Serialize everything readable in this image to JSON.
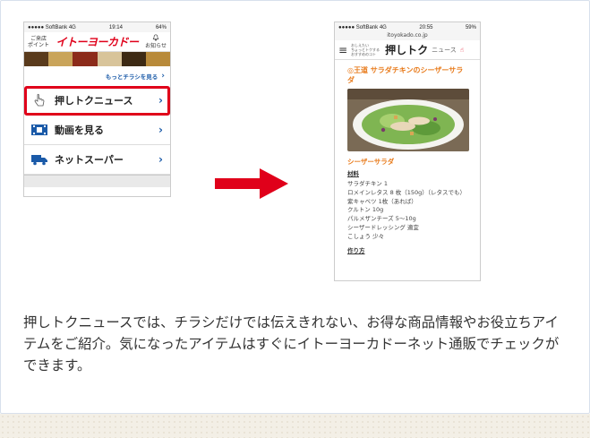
{
  "phone1": {
    "status": {
      "carrier": "●●●●● SoftBank",
      "network": "4G",
      "time": "19:14",
      "battery": "64%"
    },
    "header": {
      "store_point": [
        "ご来店",
        "ポイント"
      ],
      "logo": "イトーヨーカドー",
      "notice": "お知らせ"
    },
    "more_flyers": "もっとチラシを見る",
    "menu": [
      {
        "label": "押しトクニュース",
        "icon": "tap-hand-icon",
        "highlighted": true
      },
      {
        "label": "動画を見る",
        "icon": "film-icon",
        "highlighted": false
      },
      {
        "label": "ネットスーパー",
        "icon": "truck-icon",
        "highlighted": false
      }
    ],
    "colors": {
      "brand_red": "#e0001a",
      "link_blue": "#1a5aa8"
    }
  },
  "phone2": {
    "status": {
      "carrier": "●●●●● SoftBank",
      "network": "4G",
      "time": "20:55",
      "battery": "59%"
    },
    "url": "itoyokado.co.jp",
    "header": {
      "tagline": [
        "おしえたい",
        "ちょっとトクする",
        "おすすめのコト"
      ],
      "logo": "押しトク",
      "news": "ニュース"
    },
    "recipe_title": "◎王道 サラダチキンのシーザーサラダ",
    "section_title": "シーザーサラダ",
    "ingredients_label": "材料",
    "ingredients": [
      "サラダチキン 1",
      "ロメインレタス 8 枚（150g）（レタスでも）",
      "紫キャベツ 1枚（あれば）",
      "クルトン 10g",
      "パルメザンチーズ 5〜10g",
      "シーザードレッシング 適宜",
      "こしょう 少々"
    ],
    "howto_label": "作り方",
    "colors": {
      "accent_orange": "#e87a1a"
    }
  },
  "arrow_color": "#e0001a",
  "description": "押しトクニュースでは、チラシだけでは伝えきれない、お得な商品情報やお役立ちアイテムをご紹介。気になったアイテムはすぐにイトーヨーカドーネット通販でチェックができます。"
}
